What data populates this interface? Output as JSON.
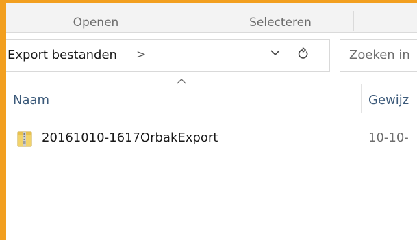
{
  "ribbon": {
    "groups": [
      {
        "label": "Openen"
      },
      {
        "label": "Selecteren"
      }
    ]
  },
  "address_bar": {
    "path": "Export bestanden",
    "crumb_chevron": ">",
    "dropdown_icon": "chevron-down-icon",
    "refresh_icon": "refresh-icon"
  },
  "search": {
    "placeholder": "Zoeken in"
  },
  "columns": {
    "name": "Naam",
    "modified": "Gewijz",
    "sort_indicator": "^"
  },
  "files": [
    {
      "name": "20161010-1617OrbakExport",
      "date": "10-10-",
      "icon": "zip-folder-icon"
    }
  ],
  "colors": {
    "window_border": "#f29f1f",
    "header_text": "#3c5a7a"
  }
}
